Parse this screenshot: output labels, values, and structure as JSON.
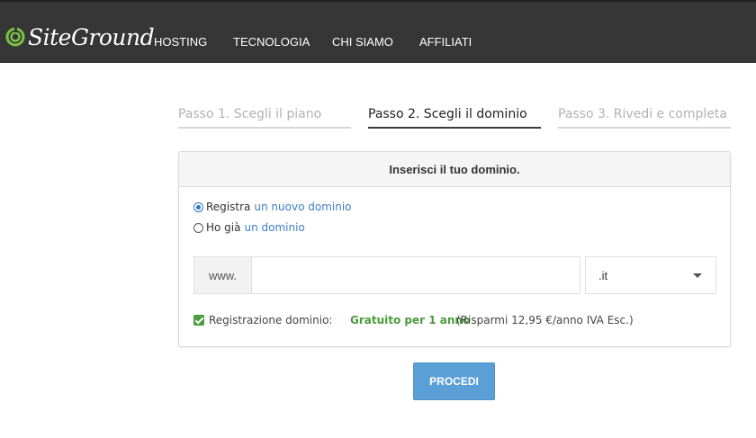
{
  "header": {
    "logo_text": "SiteGround",
    "nav": [
      "HOSTING",
      "TECNOLOGIA",
      "CHI SIAMO",
      "AFFILIATI"
    ]
  },
  "steps": [
    {
      "label": "Passo 1. Scegli il piano",
      "state": "inactive"
    },
    {
      "label": "Passo 2. Scegli il dominio",
      "state": "active"
    },
    {
      "label": "Passo 3. Rivedi e completa",
      "state": "inactive"
    }
  ],
  "panel": {
    "title": "Inserisci il tuo dominio.",
    "options": [
      {
        "prefix": "Registra",
        "link": "un nuovo dominio",
        "checked": true
      },
      {
        "prefix": "Ho già",
        "link": "un dominio",
        "checked": false
      }
    ],
    "domain": {
      "prefix": "www.",
      "value": "",
      "tld": ".it"
    },
    "registration": {
      "label": "Registrazione dominio:",
      "free": "Gratuito per 1 anno",
      "savings": "(Risparmi 12,95 €/anno IVA Esc.)",
      "checked": true
    }
  },
  "actions": {
    "proceed": "PROCEDI"
  },
  "colors": {
    "header_bg": "#363636",
    "accent_blue": "#5a9fd6",
    "link_blue": "#3d7ec5",
    "green": "#4a9c3c"
  }
}
